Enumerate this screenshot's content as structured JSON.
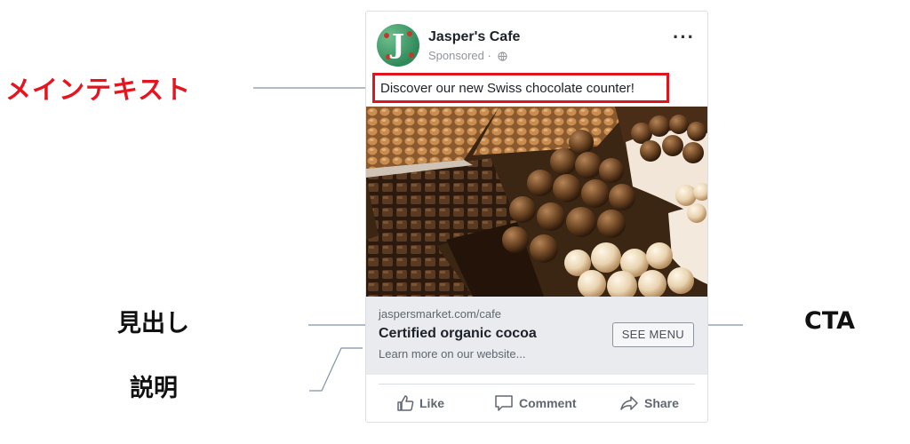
{
  "annotations": {
    "main_text": "メインテキスト",
    "headline": "見出し",
    "cta": "CTA",
    "description": "説明"
  },
  "post": {
    "page_name": "Jasper's Cafe",
    "sponsored": "Sponsored · ",
    "primary_text": "Discover our new Swiss chocolate counter!",
    "link": {
      "domain": "jaspersmarket.com/cafe",
      "headline": "Certified organic cocoa",
      "description": "Learn more on our website...",
      "cta_label": "SEE MENU"
    },
    "actions": {
      "like": "Like",
      "comment": "Comment",
      "share": "Share"
    }
  },
  "colors": {
    "highlight_red": "#e0141c",
    "link_area_bg": "#e9ebee",
    "avatar_green": "#2f8a5a"
  },
  "icons": [
    "globe-icon",
    "more-options-icon",
    "like-icon",
    "comment-icon",
    "share-icon"
  ]
}
